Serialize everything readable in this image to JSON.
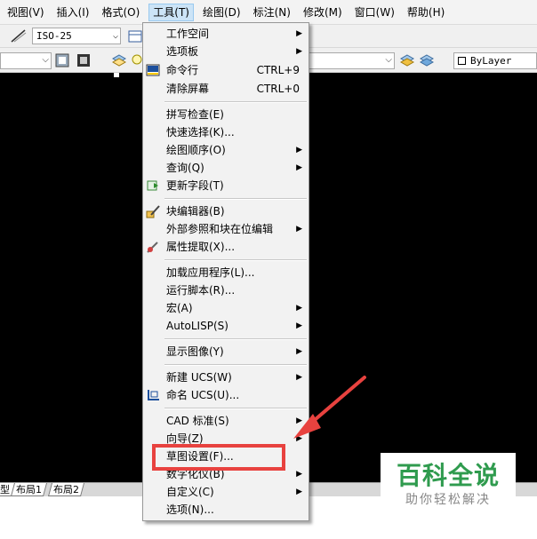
{
  "menubar": {
    "items": [
      {
        "label": "视图(V)"
      },
      {
        "label": "插入(I)"
      },
      {
        "label": "格式(O)"
      },
      {
        "label": "工具(T)"
      },
      {
        "label": "绘图(D)"
      },
      {
        "label": "标注(N)"
      },
      {
        "label": "修改(M)"
      },
      {
        "label": "窗口(W)"
      },
      {
        "label": "帮助(H)"
      }
    ]
  },
  "toolbar": {
    "dim_style": "ISO-25",
    "linetype": "ByLayer"
  },
  "layout_tabs": [
    "型",
    "布局1",
    "布局2"
  ],
  "menu": {
    "items": [
      {
        "label": "工作空间",
        "submenu": true
      },
      {
        "label": "选项板",
        "submenu": true
      },
      {
        "label": "命令行",
        "shortcut": "CTRL+9",
        "icon": "command-line-icon"
      },
      {
        "label": "清除屏幕",
        "shortcut": "CTRL+0"
      },
      {
        "label": "拼写检查(E)"
      },
      {
        "label": "快速选择(K)..."
      },
      {
        "label": "绘图顺序(O)",
        "submenu": true
      },
      {
        "label": "查询(Q)",
        "submenu": true
      },
      {
        "label": "更新字段(T)",
        "icon": "update-field-icon"
      },
      {
        "label": "块编辑器(B)",
        "icon": "block-editor-icon"
      },
      {
        "label": "外部参照和块在位编辑",
        "submenu": true
      },
      {
        "label": "属性提取(X)...",
        "icon": "attribute-extract-icon"
      },
      {
        "label": "加载应用程序(L)..."
      },
      {
        "label": "运行脚本(R)..."
      },
      {
        "label": "宏(A)",
        "submenu": true
      },
      {
        "label": "AutoLISP(S)",
        "submenu": true
      },
      {
        "label": "显示图像(Y)",
        "submenu": true
      },
      {
        "label": "新建 UCS(W)",
        "submenu": true
      },
      {
        "label": "命名 UCS(U)...",
        "icon": "named-ucs-icon"
      },
      {
        "label": "CAD 标准(S)",
        "submenu": true
      },
      {
        "label": "向导(Z)",
        "submenu": true
      },
      {
        "label": "草图设置(F)..."
      },
      {
        "label": "数字化仪(B)",
        "submenu": true
      },
      {
        "label": "自定义(C)",
        "submenu": true
      },
      {
        "label": "选项(N)..."
      }
    ]
  },
  "watermark": {
    "title": "百科全说",
    "subtitle": "助你轻松解决"
  },
  "colors": {
    "highlight": "#e8423f",
    "canvas": "#000000",
    "watermark_green": "#2f9b4e"
  }
}
